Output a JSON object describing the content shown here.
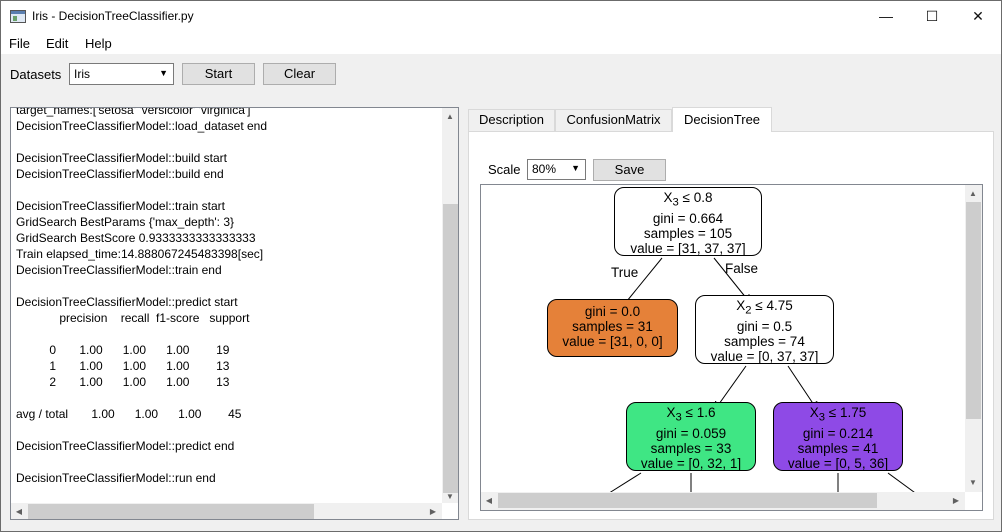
{
  "window": {
    "title": "Iris - DecisionTreeClassifier.py",
    "minimize": "—",
    "maximize": "☐",
    "close": "✕"
  },
  "menu": {
    "file": "File",
    "edit": "Edit",
    "help": "Help"
  },
  "toolbar": {
    "datasets_label": "Datasets",
    "dataset_value": "Iris",
    "start_label": "Start",
    "clear_label": "Clear"
  },
  "log": {
    "lines": [
      "target_names:['setosa' 'versicolor' 'virginica']",
      "DecisionTreeClassifierModel::load_dataset end",
      "",
      "DecisionTreeClassifierModel::build start",
      "DecisionTreeClassifierModel::build end",
      "",
      "DecisionTreeClassifierModel::train start",
      "GridSearch BestParams {'max_depth': 3}",
      "GridSearch BestScore 0.9333333333333333",
      "Train elapsed_time:14.888067245483398[sec]",
      "DecisionTreeClassifierModel::train end",
      "",
      "DecisionTreeClassifierModel::predict start",
      "             precision    recall  f1-score   support",
      "",
      "          0       1.00      1.00      1.00        19",
      "          1       1.00      1.00      1.00        13",
      "          2       1.00      1.00      1.00        13",
      "",
      "avg / total       1.00      1.00      1.00        45",
      "",
      "DecisionTreeClassifierModel::predict end",
      "",
      "DecisionTreeClassifierModel::run end"
    ]
  },
  "tabs": [
    {
      "label": "Description",
      "active": false
    },
    {
      "label": "ConfusionMatrix",
      "active": false
    },
    {
      "label": "DecisionTree",
      "active": true
    }
  ],
  "tree_controls": {
    "scale_label": "Scale",
    "scale_value": "80%",
    "save_label": "Save"
  },
  "tree": {
    "colors": {
      "root": "#ffffff",
      "setosa": "#e58139",
      "mixed": "#ffffff",
      "versicolor": "#3fe684",
      "virginica": "#8e4ae6"
    },
    "nodes": [
      {
        "id": "root",
        "feature": "X",
        "feature_sub": "3",
        "split": " ≤ 0.8",
        "gini": "gini = 0.664",
        "samples": "samples = 105",
        "value": "value = [31, 37, 37]"
      },
      {
        "id": "left",
        "gini": "gini = 0.0",
        "samples": "samples = 31",
        "value": "value = [31, 0, 0]"
      },
      {
        "id": "right",
        "feature": "X",
        "feature_sub": "2",
        "split": " ≤ 4.75",
        "gini": "gini = 0.5",
        "samples": "samples = 74",
        "value": "value = [0, 37, 37]"
      },
      {
        "id": "rl",
        "feature": "X",
        "feature_sub": "3",
        "split": " ≤ 1.6",
        "gini": "gini = 0.059",
        "samples": "samples = 33",
        "value": "value = [0, 32, 1]"
      },
      {
        "id": "rr",
        "feature": "X",
        "feature_sub": "3",
        "split": " ≤ 1.75",
        "gini": "gini = 0.214",
        "samples": "samples = 41",
        "value": "value = [0, 5, 36]"
      }
    ],
    "edge_labels": {
      "true": "True",
      "false": "False"
    }
  }
}
